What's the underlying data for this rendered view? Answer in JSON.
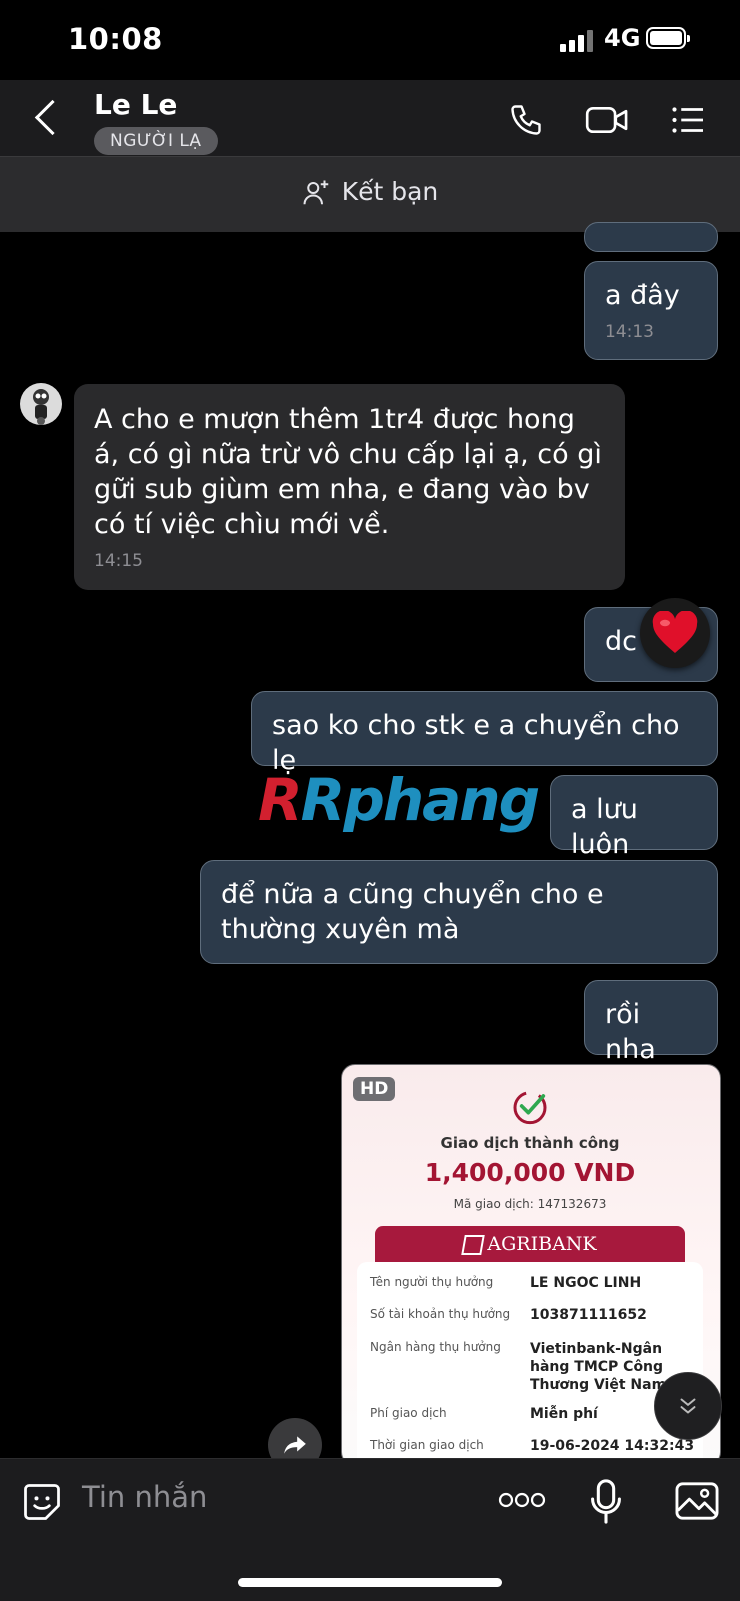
{
  "status_bar": {
    "time": "10:08",
    "network": "4G"
  },
  "header": {
    "contact_name": "Le Le",
    "badge": "NGƯỜI LẠ"
  },
  "add_friend": {
    "label": "Kết bạn"
  },
  "messages": [
    {
      "text": "a đây",
      "time": "14:13"
    },
    {
      "text": "A cho e mượn thêm 1tr4 được hong á, có gì nữa trừ vô chu cấp lại ạ, có gì gữi sub giùm em nha, e đang vào bv có tí việc chìu mới về.",
      "time": "14:15"
    },
    {
      "text": "dc",
      "reaction": "heart"
    },
    {
      "text": "sao ko cho stk e a chuyển cho lẹ"
    },
    {
      "text": "a lưu luôn"
    },
    {
      "text": "để nữa a cũng chuyển cho e thường xuyên mà"
    },
    {
      "text": "rồi nha"
    }
  ],
  "watermark": "Rphang",
  "receipt": {
    "badge": "HD",
    "title": "Giao dịch thành công",
    "amount": "1,400,000 VND",
    "code": "Mã giao dịch: 147132673",
    "bank": "AGRIBANK",
    "rows": [
      {
        "label": "Tên người thụ hưởng",
        "value": "LE NGOC LINH"
      },
      {
        "label": "Số tài khoản thụ hưởng",
        "value": "103871111652"
      },
      {
        "label": "Ngân hàng thụ hưởng",
        "value": "Vietinbank-Ngân hàng TMCP Công Thương Việt Nam"
      },
      {
        "label": "Phí giao dịch",
        "value": "Miễn phí"
      },
      {
        "label": "Thời gian giao dịch",
        "value": "19-06-2024 14:32:43"
      }
    ]
  },
  "composer": {
    "placeholder": "Tin nhắn"
  },
  "colors": {
    "outgoing_bubble": "#2c3a4a",
    "incoming_bubble": "#2a2a2c",
    "receipt_accent": "#a31533"
  }
}
